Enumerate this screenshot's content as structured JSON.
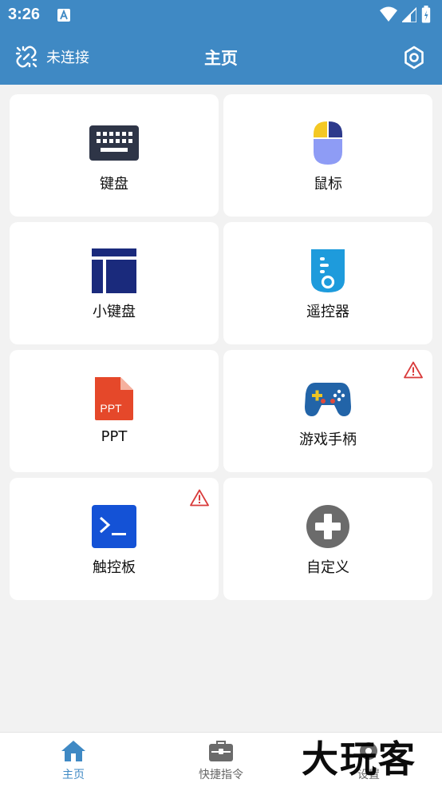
{
  "status_bar": {
    "time": "3:26",
    "icons": [
      "text-notification-icon",
      "wifi-icon",
      "signal-icon",
      "battery-icon"
    ]
  },
  "header": {
    "connection_label": "未连接",
    "title": "主页",
    "connection_icon": "broken-link-icon",
    "settings_icon": "gear-icon"
  },
  "tiles": [
    {
      "label": "键盘",
      "icon": "keyboard-icon",
      "warning": false
    },
    {
      "label": "鼠标",
      "icon": "mouse-icon",
      "warning": false
    },
    {
      "label": "小键盘",
      "icon": "numpad-icon",
      "warning": false
    },
    {
      "label": "遥控器",
      "icon": "remote-control-icon",
      "warning": false
    },
    {
      "label": "PPT",
      "icon": "ppt-file-icon",
      "icon_text": "PPT",
      "warning": false
    },
    {
      "label": "游戏手柄",
      "icon": "gamepad-icon",
      "warning": true
    },
    {
      "label": "触控板",
      "icon": "terminal-icon",
      "warning": true
    },
    {
      "label": "自定义",
      "icon": "add-circle-icon",
      "warning": false
    }
  ],
  "bottom_nav": {
    "items": [
      {
        "label": "主页",
        "icon": "home-icon",
        "active": true
      },
      {
        "label": "快捷指令",
        "icon": "toolbox-icon",
        "active": false
      },
      {
        "label": "设置",
        "icon": "settings-icon",
        "active": false
      }
    ]
  },
  "watermark": {
    "text": "大玩客"
  },
  "colors": {
    "primary": "#3f89c4",
    "background": "#f2f2f2",
    "card": "#ffffff",
    "warning": "#d93b3b"
  }
}
